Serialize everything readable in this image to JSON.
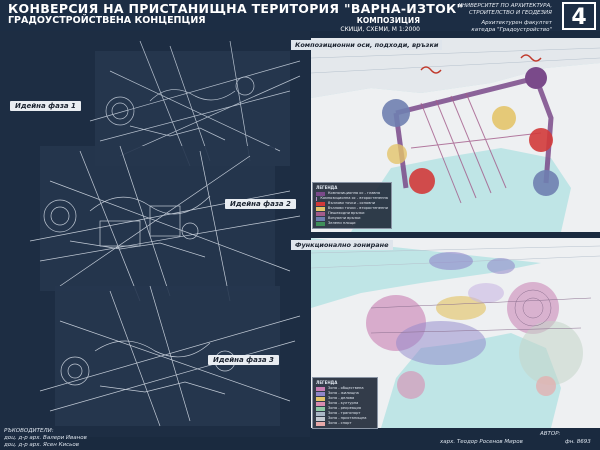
{
  "header": {
    "title": "КОНВЕРСИЯ НА ПРИСТАНИЩНА ТЕРИТОРИЯ \"ВАРНА-ИЗТОК\"",
    "subtitle": "ГРАДОУСТРОЙСТВЕНА КОНЦЕПЦИЯ",
    "university_line1": "УНИВЕРСИТЕТ ПО АРХИТЕКТУРА,",
    "university_line2": "СТРОИТЕЛСТВО И ГЕОДЕЗИЯ",
    "faculty_line1": "Архитектурен факултет",
    "faculty_line2": "катедра \"Градоустройство\"",
    "sheet_number": "4",
    "composition_title": "КОМПОЗИЦИЯ",
    "composition_scale": "СКИЦИ, СХЕМИ, М 1:2000"
  },
  "phases": {
    "phase1": "Идейна фаза 1",
    "phase2": "Идейна фаза 2",
    "phase3": "Идейна фаза 3"
  },
  "maps": {
    "top_title": "Композиционни оси, подходи, връзки",
    "bottom_title": "Функционално зониране"
  },
  "legend_top": {
    "title": "ЛЕГЕНДА",
    "items": [
      {
        "label": "Композиционна ос - главна",
        "color": "#7a4a8a"
      },
      {
        "label": "Композиционна ос - второстепенна",
        "color": "#b08cc0"
      },
      {
        "label": "Възлови точки - основни",
        "color": "#d23a3a"
      },
      {
        "label": "Възлови точки - второстепенни",
        "color": "#e3c46a"
      },
      {
        "label": "Пешеходни връзки",
        "color": "#a35b8a"
      },
      {
        "label": "Визуални връзки",
        "color": "#6f7fb0"
      },
      {
        "label": "Зелени площи",
        "color": "#3f8f5a"
      }
    ]
  },
  "legend_bottom": {
    "title": "ЛЕГЕНДА",
    "items": [
      {
        "label": "Зона - обществена",
        "color": "#c97fb3"
      },
      {
        "label": "Зона - жилищна",
        "color": "#8f86c9"
      },
      {
        "label": "Зона - делова",
        "color": "#e3c46a"
      },
      {
        "label": "Зона - културна",
        "color": "#d88bb0"
      },
      {
        "label": "Зона - рекреация",
        "color": "#8fc9a5"
      },
      {
        "label": "Зона - транспорт",
        "color": "#aab7c6"
      },
      {
        "label": "Зона - пристанищна",
        "color": "#c5cbd3"
      },
      {
        "label": "Зона - спорт",
        "color": "#e7a9a9"
      }
    ]
  },
  "footer": {
    "supervisors_label": "РЪКОВОДИТЕЛИ:",
    "supervisor1": "доц. д-р арх. Валери Иванов",
    "supervisor2": "доц. д-р арх. Ясен Кисьов",
    "author_label": "АВТОР:",
    "author_name": "харх. Теодор Росенов Миров",
    "faculty_number": "фн. 8693"
  },
  "colors": {
    "background": "#1a2a3f",
    "water": "#bfe5e6",
    "land": "#eef0f2",
    "header": "#1c2d44"
  }
}
